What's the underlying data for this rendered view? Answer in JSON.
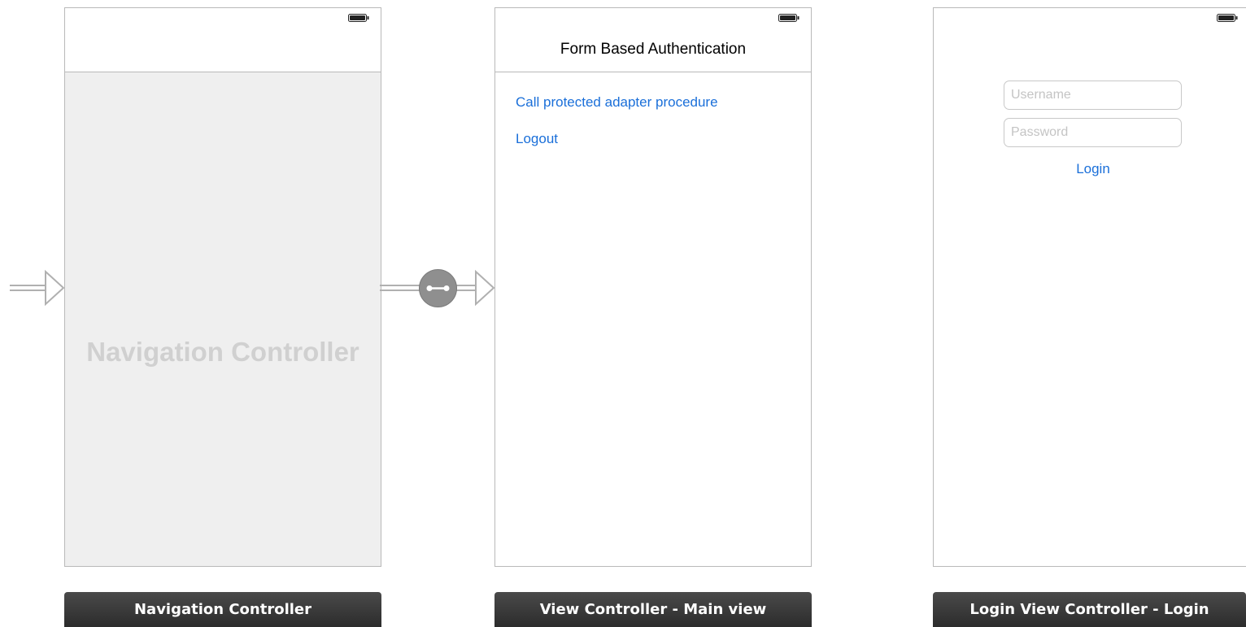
{
  "navigation_controller": {
    "placeholder": "Navigation Controller",
    "label": "Navigation Controller"
  },
  "main_view": {
    "title": "Form Based Authentication",
    "buttons": [
      "Call protected adapter procedure",
      "Logout"
    ],
    "label": "View Controller - Main view"
  },
  "login_view": {
    "username_placeholder": "Username",
    "password_placeholder": "Password",
    "login_label": "Login",
    "label": "Login View Controller - Login"
  },
  "icons": {
    "battery": "battery-icon",
    "segue": "segue-push-icon",
    "entry_arrow": "initial-arrow-icon"
  },
  "colors": {
    "link": "#1a6fd9",
    "scene_border": "#b9b9b9",
    "label_bar": "#2c2c2c",
    "nav_body": "#efefef"
  }
}
